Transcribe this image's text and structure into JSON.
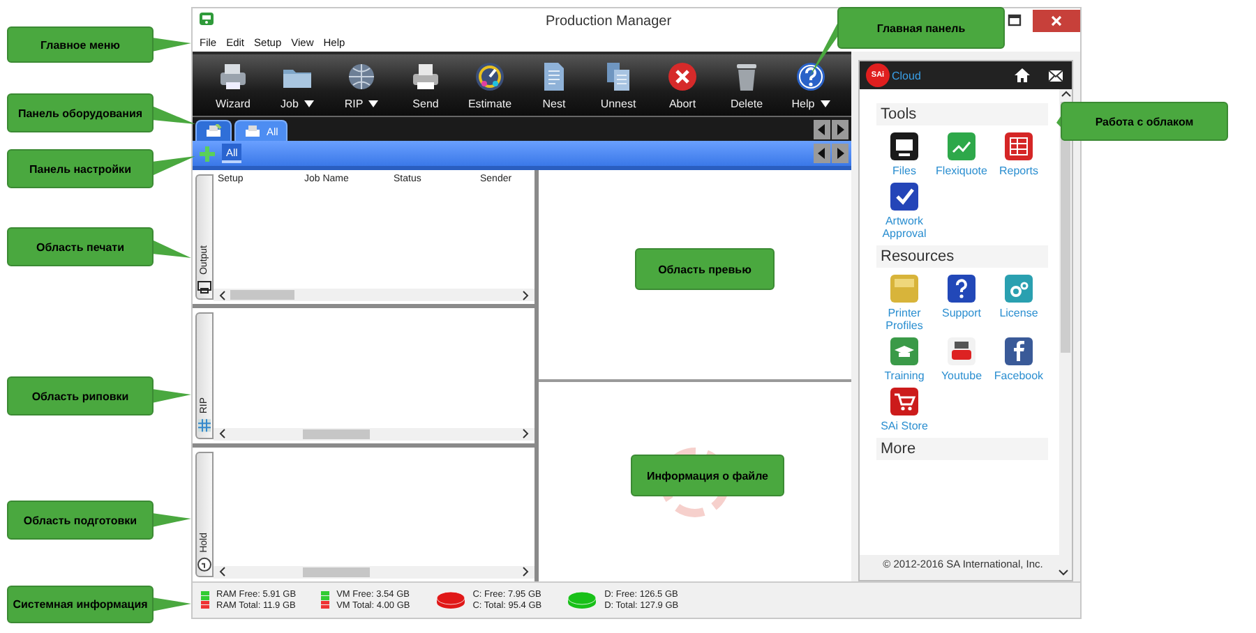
{
  "window": {
    "title": "Production Manager"
  },
  "menu": [
    "File",
    "Edit",
    "Setup",
    "View",
    "Help"
  ],
  "toolbar": [
    {
      "label": "Wizard",
      "dropdown": false
    },
    {
      "label": "Job",
      "dropdown": true
    },
    {
      "label": "RIP",
      "dropdown": true
    },
    {
      "label": "Send",
      "dropdown": false
    },
    {
      "label": "Estimate",
      "dropdown": false
    },
    {
      "label": "Nest",
      "dropdown": false
    },
    {
      "label": "Unnest",
      "dropdown": false
    },
    {
      "label": "Abort",
      "dropdown": false
    },
    {
      "label": "Delete",
      "dropdown": false
    },
    {
      "label": "Help",
      "dropdown": true
    }
  ],
  "device_tabs": [
    {
      "kind": "icon",
      "selected": false
    },
    {
      "kind": "labeled",
      "label": "All",
      "selected": true
    }
  ],
  "setup_tabs": [
    {
      "label": "All",
      "selected": true
    }
  ],
  "queues": [
    {
      "label": "Output",
      "columns": [
        "Setup",
        "Job Name",
        "Status",
        "Sender"
      ]
    },
    {
      "label": "RIP"
    },
    {
      "label": "Hold"
    }
  ],
  "cloud": {
    "logo": "SAi",
    "brand": "Cloud",
    "sections": [
      {
        "title": "Tools",
        "items": [
          "Files",
          "Flexiquote",
          "Reports",
          "Artwork Approval"
        ]
      },
      {
        "title": "Resources",
        "items": [
          "Printer Profiles",
          "Support",
          "License",
          "Training",
          "Youtube",
          "Facebook",
          "SAi Store"
        ]
      },
      {
        "title": "More"
      }
    ],
    "footer": "© 2012-2016 SA International, Inc."
  },
  "status_bar": [
    {
      "kind": "memory",
      "lines": [
        "RAM Free: 5.91 GB",
        "RAM Total: 11.9 GB"
      ]
    },
    {
      "kind": "memory",
      "lines": [
        "VM Free: 3.54 GB",
        "VM Total: 4.00 GB"
      ]
    },
    {
      "kind": "disk",
      "color": "#e01818",
      "lines": [
        "C: Free: 7.95 GB",
        "C: Total: 95.4 GB"
      ]
    },
    {
      "kind": "disk",
      "color": "#18c018",
      "lines": [
        "D: Free: 126.5 GB",
        "D: Total: 127.9 GB"
      ]
    }
  ],
  "callouts": [
    {
      "text": "Главное меню"
    },
    {
      "text": "Панель оборудования"
    },
    {
      "text": "Панель настройки"
    },
    {
      "text": "Область печати"
    },
    {
      "text": "Область риповки"
    },
    {
      "text": "Область подготовки"
    },
    {
      "text": "Системная информация"
    },
    {
      "text": "Главная панель"
    },
    {
      "text": "Работа с облаком"
    },
    {
      "text": "Область превью"
    },
    {
      "text": "Информация о файле"
    }
  ]
}
